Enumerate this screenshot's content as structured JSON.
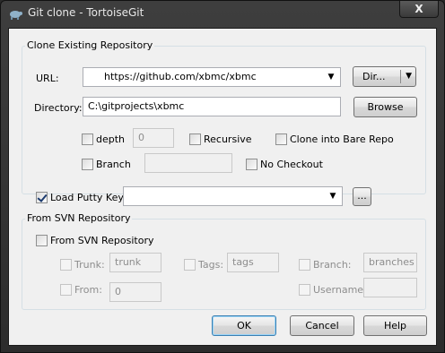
{
  "window": {
    "title": "Git clone - TortoiseGit",
    "close_glyph": "X",
    "app_icon": "tortoise-icon"
  },
  "clone_group": {
    "title": "Clone Existing Repository",
    "url_label": "URL:",
    "url_value": "https://github.com/xbmc/xbmc",
    "dir_button": "Dir...",
    "directory_label": "Directory:",
    "directory_value": "C:\\gitprojects\\xbmc",
    "browse_button": "Browse",
    "depth_label": "depth",
    "depth_value": "0",
    "depth_checked": false,
    "recursive_label": "Recursive",
    "recursive_checked": false,
    "bare_label": "Clone into Bare Repo",
    "bare_checked": false,
    "branch_label": "Branch",
    "branch_checked": false,
    "branch_value": "",
    "no_checkout_label": "No Checkout",
    "no_checkout_checked": false
  },
  "putty": {
    "label": "Load Putty Key",
    "checked": true,
    "key_value": "",
    "browse_button": "..."
  },
  "svn_group": {
    "title": "From SVN Repository",
    "enable_label": "From SVN Repository",
    "enable_checked": false,
    "trunk_label": "Trunk:",
    "trunk_value": "trunk",
    "tags_label": "Tags:",
    "tags_value": "tags",
    "branch_label": "Branch:",
    "branch_value": "branches",
    "from_label": "From:",
    "from_value": "0",
    "username_label": "Username:",
    "username_value": ""
  },
  "buttons": {
    "ok": "OK",
    "cancel": "Cancel",
    "help": "Help"
  }
}
